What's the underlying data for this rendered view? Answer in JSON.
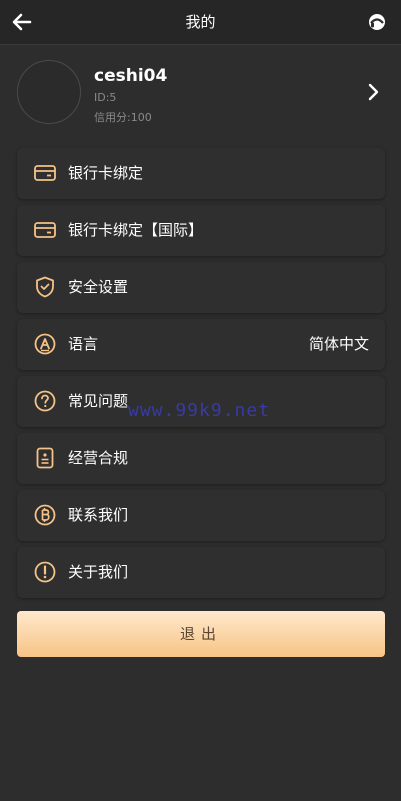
{
  "header": {
    "title": "我的"
  },
  "profile": {
    "username": "ceshi04",
    "id_text": "ID:5",
    "credit_text": "信用分:100"
  },
  "menu": [
    {
      "label": "银行卡绑定"
    },
    {
      "label": "银行卡绑定【国际】"
    },
    {
      "label": "安全设置"
    },
    {
      "label": "语言",
      "value": "简体中文"
    },
    {
      "label": "常见问题"
    },
    {
      "label": "经营合规"
    },
    {
      "label": "联系我们"
    },
    {
      "label": "关于我们"
    }
  ],
  "logout": {
    "label": "退出"
  },
  "watermark": "www.99k9.net",
  "colors": {
    "background": "#2d2d2d",
    "accent": "#f5c287",
    "text": "#ffffff"
  },
  "icons": [
    "back-arrow-icon",
    "headset-icon",
    "chevron-right-icon",
    "card-icon",
    "card-icon",
    "shield-icon",
    "language-a-icon",
    "question-icon",
    "compliance-doc-icon",
    "bitcoin-icon",
    "info-exclamation-icon"
  ]
}
